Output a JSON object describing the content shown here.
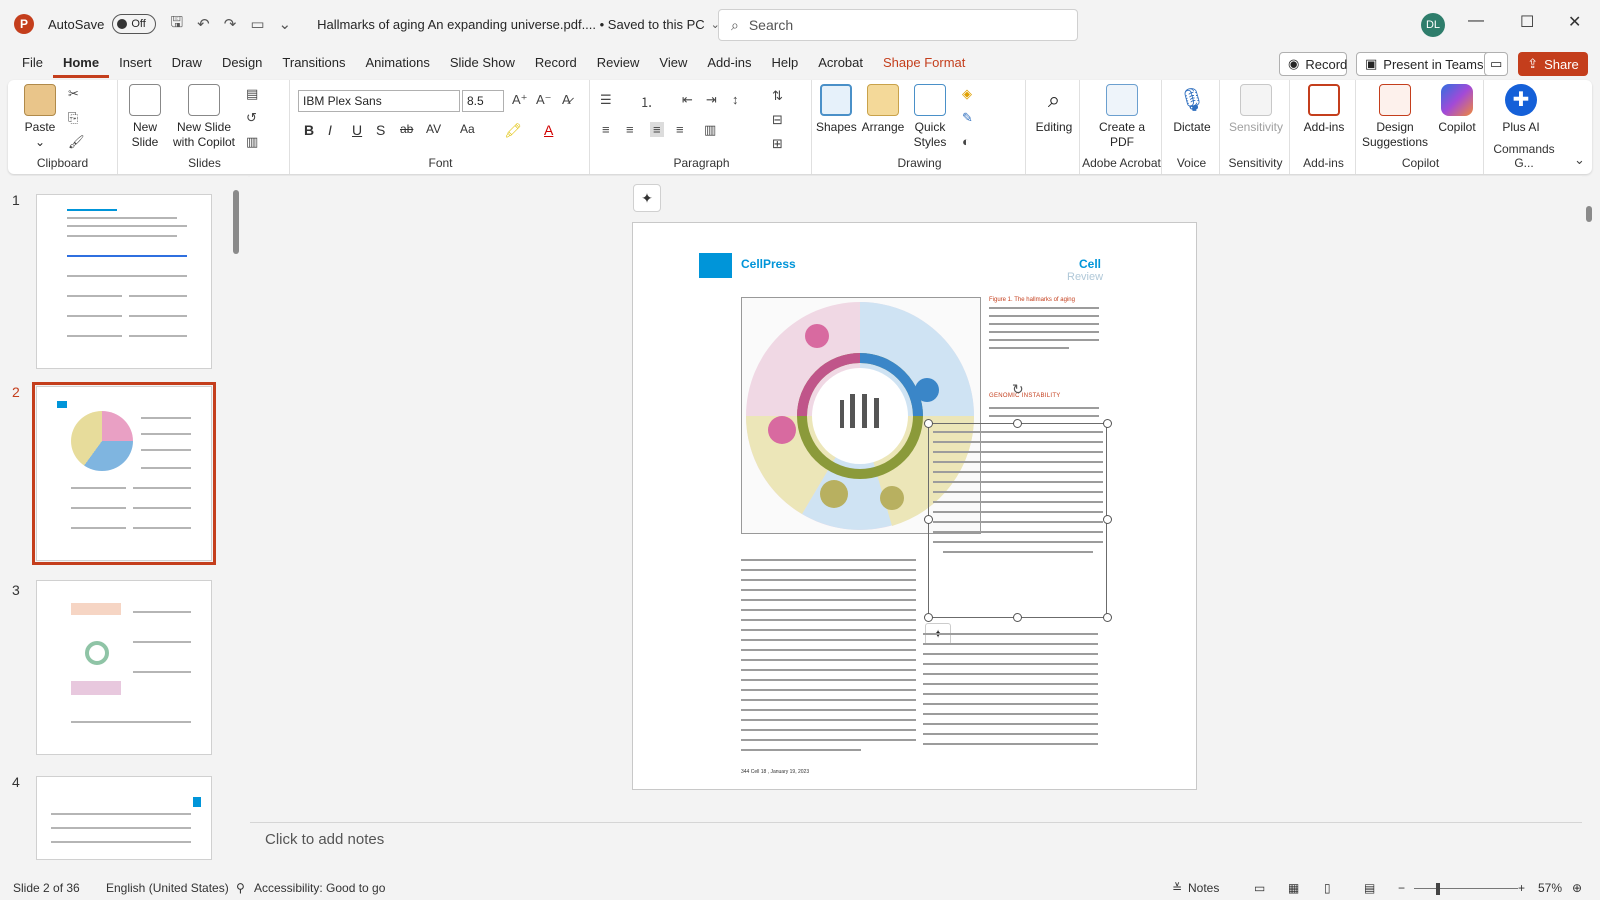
{
  "titlebar": {
    "app_letter": "P",
    "autosave_label": "AutoSave",
    "autosave_state": "Off",
    "document_title": "Hallmarks of aging An expanding universe.pdf.... • Saved to this PC",
    "search_placeholder": "Search",
    "user_initials": "DL"
  },
  "tabs": [
    "File",
    "Home",
    "Insert",
    "Draw",
    "Design",
    "Transitions",
    "Animations",
    "Slide Show",
    "Record",
    "Review",
    "View",
    "Add-ins",
    "Help",
    "Acrobat",
    "Shape Format"
  ],
  "tab_buttons": {
    "record": "Record",
    "present": "Present in Teams",
    "share": "Share"
  },
  "ribbon": {
    "clipboard": {
      "label": "Clipboard",
      "paste": "Paste"
    },
    "slides": {
      "label": "Slides",
      "new_slide": "New Slide",
      "new_slide_copilot": "New Slide with Copilot"
    },
    "font": {
      "label": "Font",
      "font_name": "IBM Plex Sans",
      "font_size": "8.5"
    },
    "paragraph": {
      "label": "Paragraph"
    },
    "drawing": {
      "label": "Drawing",
      "shapes": "Shapes",
      "arrange": "Arrange",
      "quick_styles": "Quick Styles"
    },
    "editing": {
      "label": "Editing"
    },
    "adobe": {
      "label": "Adobe Acrobat",
      "create_pdf": "Create a PDF"
    },
    "voice": {
      "label": "Voice",
      "dictate": "Dictate"
    },
    "sensitivity": {
      "label": "Sensitivity",
      "button": "Sensitivity"
    },
    "addins": {
      "label": "Add-ins",
      "button": "Add-ins"
    },
    "copilot": {
      "label": "Copilot",
      "design": "Design Suggestions",
      "copilot": "Copilot"
    },
    "commands": {
      "label": "Commands G...",
      "plus": "Plus AI"
    }
  },
  "thumbnails": [
    {
      "number": "1"
    },
    {
      "number": "2"
    },
    {
      "number": "3"
    },
    {
      "number": "4"
    }
  ],
  "slide": {
    "brand": "CellPress",
    "journal": "Cell",
    "review": "Review",
    "figure_title": "Figure 1. The hallmarks of aging",
    "section_head": "GENOMIC INSTABILITY",
    "footer": "344   Cell 18 , January 19, 2023"
  },
  "notes_placeholder": "Click to add notes",
  "statusbar": {
    "slide_info": "Slide 2 of 36",
    "language": "English (United States)",
    "accessibility": "Accessibility: Good to go",
    "notes": "Notes",
    "zoom": "57%"
  },
  "colors": {
    "accent": "#c43e1c",
    "cell_blue": "#0095d9"
  }
}
